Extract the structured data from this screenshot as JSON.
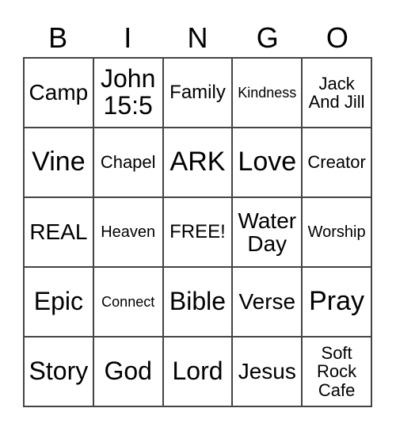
{
  "header": [
    "B",
    "I",
    "N",
    "G",
    "O"
  ],
  "cells": [
    "Camp",
    "John\n15:5",
    "Family",
    "Kindness",
    "Jack\nAnd Jill",
    "Vine",
    "Chapel",
    "ARK",
    "Love",
    "Creator",
    "REAL",
    "Heaven",
    "FREE!",
    "Water\nDay",
    "Worship",
    "Epic",
    "Connect",
    "Bible",
    "Verse",
    "Pray",
    "Story",
    "God",
    "Lord",
    "Jesus",
    "Soft\nRock\nCafe"
  ]
}
